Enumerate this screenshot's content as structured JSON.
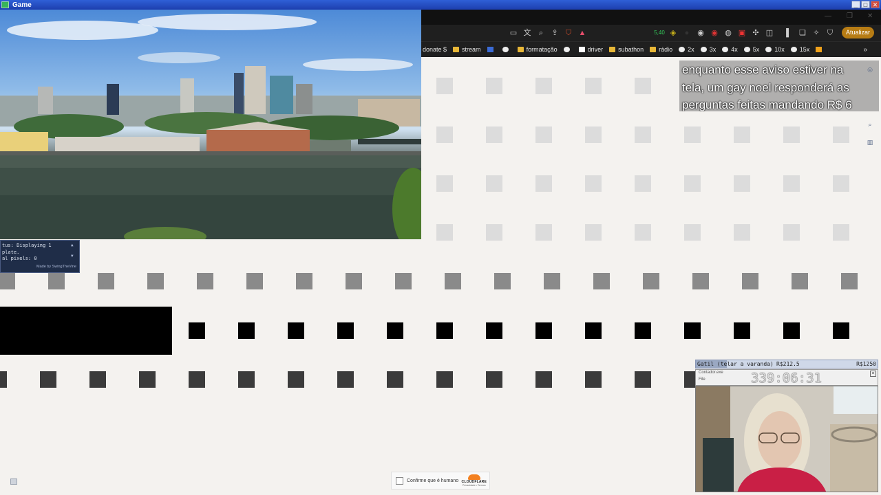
{
  "window": {
    "title": "Game"
  },
  "browser": {
    "toolbar": {
      "update_label": "Atualizar",
      "badge_count": "5,40"
    },
    "bookmarks": [
      {
        "label": "donate $",
        "icon": "none"
      },
      {
        "label": "stream",
        "icon": "folder"
      },
      {
        "label": "",
        "icon": "blue"
      },
      {
        "label": "",
        "icon": "round"
      },
      {
        "label": "formatação",
        "icon": "folder"
      },
      {
        "label": "",
        "icon": "round"
      },
      {
        "label": "driver",
        "icon": "white"
      },
      {
        "label": "subathon",
        "icon": "folder"
      },
      {
        "label": "rádio",
        "icon": "folder"
      },
      {
        "label": "2x",
        "icon": "round"
      },
      {
        "label": "3x",
        "icon": "round"
      },
      {
        "label": "4x",
        "icon": "round"
      },
      {
        "label": "5x",
        "icon": "round"
      },
      {
        "label": "10x",
        "icon": "round"
      },
      {
        "label": "15x",
        "icon": "round"
      },
      {
        "label": "",
        "icon": "yellow"
      }
    ]
  },
  "console": {
    "lines": [
      "tus: Displaying 1",
      "plate.",
      "al pixels: 0"
    ],
    "credit": "Made by SwingTheVine"
  },
  "notice": {
    "lines": [
      "enquanto esse aviso estiver na",
      "tela, um gay noel responderá as",
      "perguntas feitas mandando R$ 6"
    ]
  },
  "goal": {
    "name": "Gatil (telar a varanda)",
    "amount": "R$212.5",
    "target": "R$1250",
    "progress_fraction": 0.17
  },
  "timer": {
    "window_title": "Contador.exe",
    "menu": "File",
    "time": "339:06:31"
  },
  "captcha": {
    "label": "Confirme que é humano",
    "brand": "CLOUDFLARE",
    "links": "Privacidade • Termos"
  },
  "colors": {
    "light_square": "#dcdcdc",
    "mid_square": "#8a8a8a",
    "black_square": "#000000",
    "dark_square": "#3b3b3b",
    "update_button": "#b77c14"
  }
}
